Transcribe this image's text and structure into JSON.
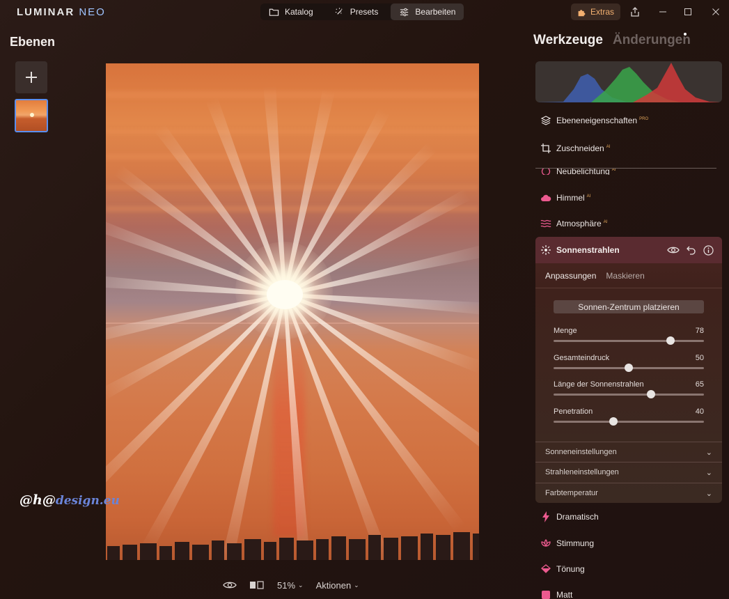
{
  "app": {
    "logo_main": "LUMINAR",
    "logo_sub": "NEO"
  },
  "nav": {
    "katalog": "Katalog",
    "presets": "Presets",
    "bearbeiten": "Bearbeiten",
    "extras": "Extras"
  },
  "left": {
    "title": "Ebenen"
  },
  "watermark": {
    "prefix": "@h@",
    "suffix": "design.eu"
  },
  "bottombar": {
    "zoom": "51%",
    "actions": "Aktionen"
  },
  "right": {
    "tab_tools": "Werkzeuge",
    "tab_changes": "Änderungen",
    "tools": [
      {
        "label": "Ebeneneigenschaften",
        "badge": "PRO",
        "icon": "layers-icon"
      },
      {
        "label": "Zuschneiden",
        "badge": "AI",
        "icon": "crop-icon"
      },
      {
        "label": "Neubelichtung",
        "badge": "AI",
        "icon": "relight-icon"
      },
      {
        "label": "Himmel",
        "badge": "AI",
        "icon": "cloud-icon"
      },
      {
        "label": "Atmosphäre",
        "badge": "AI",
        "icon": "atmosphere-icon"
      }
    ],
    "active_tool": {
      "label": "Sonnenstrahlen",
      "subtab_active": "Anpassungen",
      "subtab_inactive": "Maskieren",
      "place_button": "Sonnen-Zentrum platzieren",
      "sliders": [
        {
          "label": "Menge",
          "value": 78
        },
        {
          "label": "Gesamteindruck",
          "value": 50
        },
        {
          "label": "Länge der Sonnenstrahlen",
          "value": 65
        },
        {
          "label": "Penetration",
          "value": 40
        }
      ],
      "sections": [
        "Sonneneinstellungen",
        "Strahleneinstellungen",
        "Farbtemperatur"
      ]
    },
    "tools_below": [
      {
        "label": "Dramatisch",
        "icon": "lightning-icon"
      },
      {
        "label": "Stimmung",
        "icon": "lotus-icon"
      },
      {
        "label": "Tönung",
        "icon": "bucket-icon"
      },
      {
        "label": "Matt",
        "icon": "matt-icon"
      }
    ]
  },
  "colors": {
    "accent_pink": "#ec5a8f",
    "accent_orange": "#f3b070",
    "selection_blue": "#5a8ff0"
  }
}
